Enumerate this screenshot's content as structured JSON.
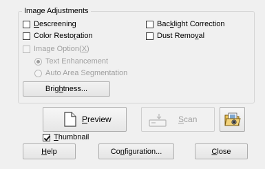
{
  "group": {
    "title": "Image Adjustments"
  },
  "options": {
    "descreening": {
      "pre": "",
      "key": "D",
      "post": "escreening"
    },
    "backlight": {
      "pre": "Bac",
      "key": "k",
      "post": "light Correction"
    },
    "color_restoration": {
      "pre": "Color Resto",
      "key": "r",
      "post": "ation"
    },
    "dust_removal": {
      "pre": "Dust Remo",
      "key": "v",
      "post": "al"
    },
    "image_option": {
      "pre": "Image Option(",
      "key": "X",
      "post": ")"
    }
  },
  "radios": {
    "text_enhancement": "Text Enhancement",
    "auto_area": "Auto Area Segmentation"
  },
  "buttons": {
    "brightness": {
      "pre": "Brig",
      "key": "h",
      "post": "tness..."
    },
    "preview": {
      "pre": "",
      "key": "P",
      "post": "review"
    },
    "scan": {
      "pre": "",
      "key": "S",
      "post": "can"
    },
    "help": {
      "pre": "",
      "key": "H",
      "post": "elp"
    },
    "configuration": {
      "pre": "Co",
      "key": "n",
      "post": "figuration..."
    },
    "close": {
      "pre": "",
      "key": "C",
      "post": "lose"
    }
  },
  "thumbnail": {
    "pre": "",
    "key": "T",
    "post": "humbnail",
    "checked": true
  },
  "colors": {
    "background": "#f0f0f0",
    "disabled_text": "#a0a0a0"
  }
}
